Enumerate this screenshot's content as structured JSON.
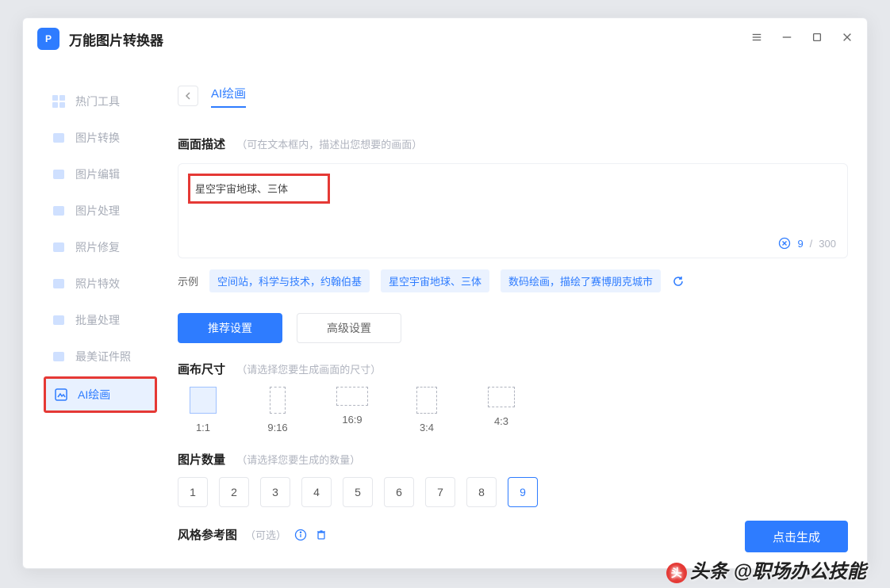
{
  "app": {
    "title": "万能图片转换器"
  },
  "sidebar": {
    "items": [
      {
        "label": "热门工具"
      },
      {
        "label": "图片转换"
      },
      {
        "label": "图片编辑"
      },
      {
        "label": "图片处理"
      },
      {
        "label": "照片修复"
      },
      {
        "label": "照片特效"
      },
      {
        "label": "批量处理"
      },
      {
        "label": "最美证件照"
      },
      {
        "label": "AI绘画"
      }
    ]
  },
  "page": {
    "title": "AI绘画",
    "desc": {
      "title": "画面描述",
      "hint": "（可在文本框内，描述出您想要的画面）",
      "value": "星空宇宙地球、三体",
      "count": "9",
      "max": "300"
    },
    "examples": {
      "label": "示例",
      "items": [
        "空间站，科学与技术，约翰伯基",
        "星空宇宙地球、三体",
        "数码绘画，描绘了赛博朋克城市"
      ]
    },
    "tabs": {
      "rec": "推荐设置",
      "adv": "高级设置"
    },
    "canvas": {
      "title": "画布尺寸",
      "hint": "（请选择您要生成画面的尺寸）",
      "sizes": [
        "1:1",
        "9:16",
        "16:9",
        "3:4",
        "4:3"
      ]
    },
    "count": {
      "title": "图片数量",
      "hint": "（请选择您要生成的数量）",
      "opts": [
        "1",
        "2",
        "3",
        "4",
        "5",
        "6",
        "7",
        "8",
        "9"
      ]
    },
    "style": {
      "title": "风格参考图",
      "hint": "（可选）"
    },
    "generate": "点击生成"
  },
  "watermark": "头条 @职场办公技能"
}
